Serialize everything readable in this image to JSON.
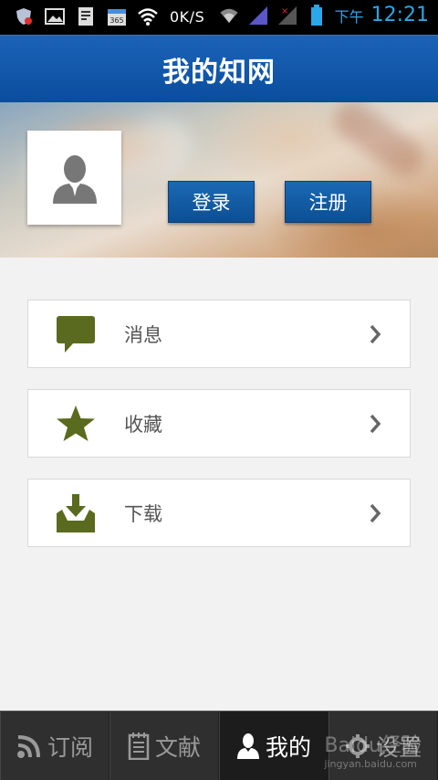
{
  "status_bar": {
    "network_speed": "0K/S",
    "time_label": "下午",
    "time": "12:21",
    "icons": [
      "shield-icon",
      "image-icon",
      "document-icon",
      "calendar-365-icon",
      "wifi-icon",
      "wifi-signal-icon",
      "cellular-signal-icon",
      "no-signal-icon",
      "battery-icon"
    ]
  },
  "title_bar": {
    "title": "我的知网"
  },
  "header": {
    "avatar_icon": "user-avatar-icon",
    "login_label": "登录",
    "register_label": "注册"
  },
  "menu": {
    "items": [
      {
        "label": "消息",
        "icon": "message-bubble-icon"
      },
      {
        "label": "收藏",
        "icon": "star-icon"
      },
      {
        "label": "下载",
        "icon": "download-tray-icon"
      }
    ]
  },
  "tabbar": {
    "tabs": [
      {
        "label": "订阅",
        "icon": "rss-icon",
        "active": false
      },
      {
        "label": "文献",
        "icon": "notebook-icon",
        "active": false
      },
      {
        "label": "我的",
        "icon": "user-icon",
        "active": true
      },
      {
        "label": "设置",
        "icon": "gear-icon",
        "active": false
      }
    ]
  },
  "watermark": {
    "text": "Baidu经验",
    "subtext": "jingyan.baidu.com"
  },
  "colors": {
    "title_bar": "#0a4d9d",
    "menu_icon": "#5a6a1e",
    "status_time": "#2aa7e8",
    "tabbar_bg": "#2f2f2f"
  }
}
